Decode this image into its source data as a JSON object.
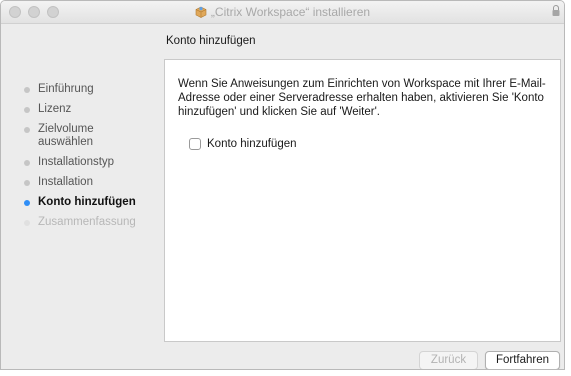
{
  "window": {
    "title": "„Citrix Workspace“ installieren"
  },
  "section_title": "Konto hinzufügen",
  "sidebar": {
    "steps": [
      {
        "label": "Einführung",
        "state": "done"
      },
      {
        "label": "Lizenz",
        "state": "done"
      },
      {
        "label": "Zielvolume auswählen",
        "state": "done"
      },
      {
        "label": "Installationstyp",
        "state": "done"
      },
      {
        "label": "Installation",
        "state": "done"
      },
      {
        "label": "Konto hinzufügen",
        "state": "active"
      },
      {
        "label": "Zusammenfassung",
        "state": "future"
      }
    ]
  },
  "content": {
    "description": "Wenn Sie Anweisungen zum Einrichten von Workspace mit Ihrer E-Mail-Adresse oder einer Serveradresse erhalten haben, aktivieren Sie 'Konto hinzufügen' und klicken Sie auf 'Weiter'.",
    "checkbox_label": "Konto hinzufügen",
    "checkbox_checked": false
  },
  "buttons": {
    "back_label": "Zurück",
    "continue_label": "Fortfahren"
  },
  "colors": {
    "active_step": "#2f8ef6",
    "inactive_step_dot": "#c6c6c6"
  }
}
